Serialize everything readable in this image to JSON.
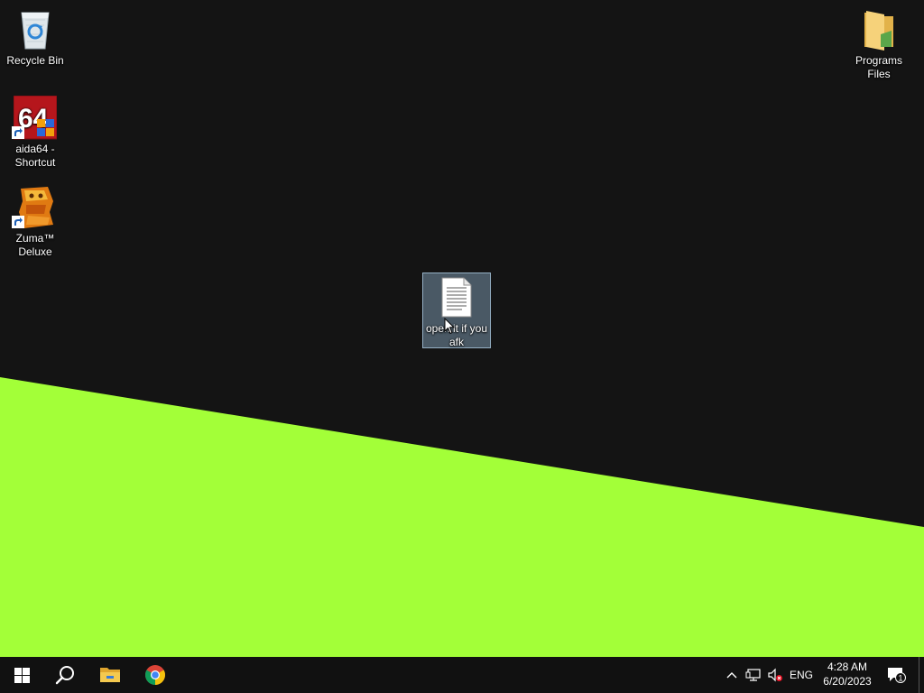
{
  "desktop": {
    "icons": [
      {
        "label": "Recycle Bin",
        "icon": "recycle-bin-icon"
      },
      {
        "label": "aida64 - Shortcut",
        "icon": "aida64-icon",
        "badge_text": "64"
      },
      {
        "label": "Zuma™ Deluxe",
        "icon": "zuma-icon"
      },
      {
        "label": "open it if you afk",
        "icon": "text-document-icon",
        "selected": true
      },
      {
        "label": "Programs Files",
        "icon": "folder-icon"
      }
    ],
    "wallpaper_colors": {
      "background": "#141414",
      "accent": "#a3ff38"
    }
  },
  "taskbar": {
    "apps": [
      {
        "name": "Start",
        "icon": "windows-logo-icon"
      },
      {
        "name": "Search",
        "icon": "search-icon"
      },
      {
        "name": "File Explorer",
        "icon": "file-explorer-icon"
      },
      {
        "name": "Google Chrome",
        "icon": "chrome-icon"
      }
    ],
    "tray": {
      "language": "ENG",
      "time": "4:28 AM",
      "date": "6/20/2023",
      "notification_count": "1"
    }
  }
}
